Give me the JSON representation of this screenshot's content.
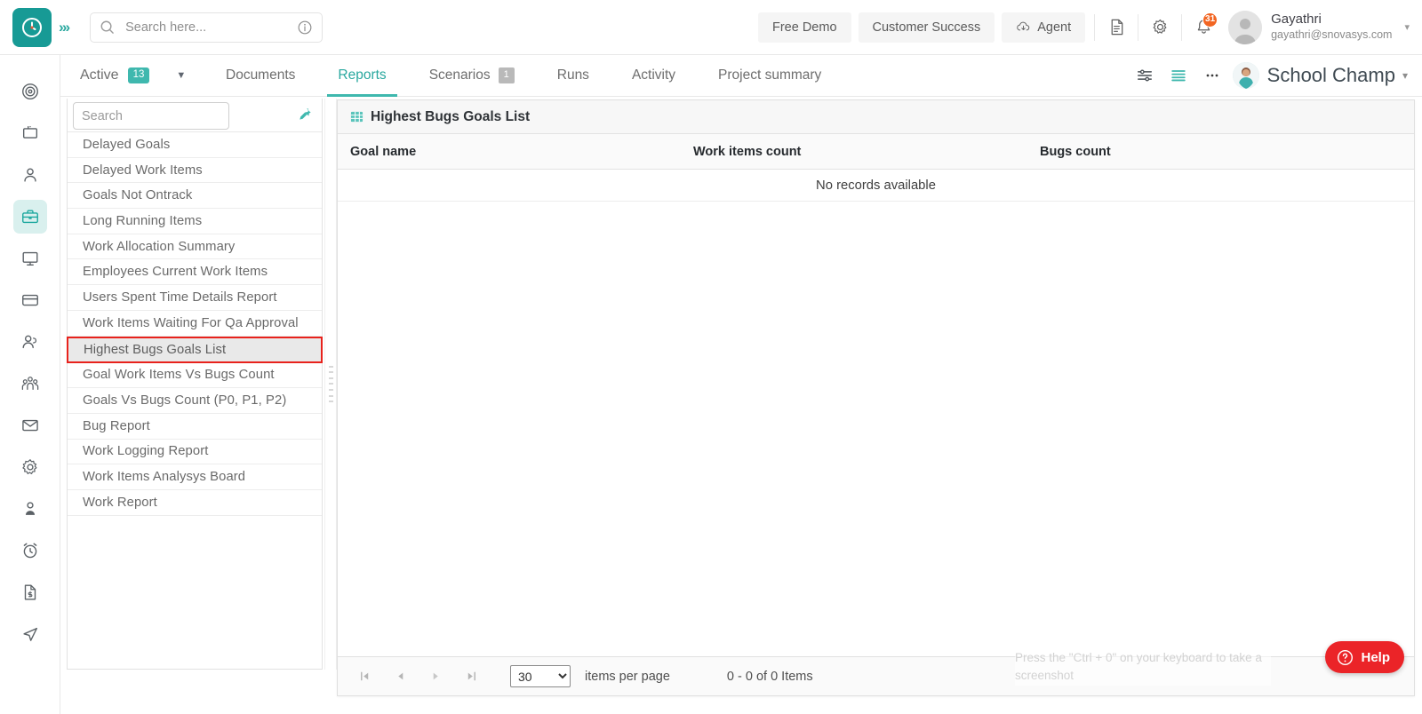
{
  "header": {
    "logo_icon": "clock-logo-icon",
    "expand_icon": "chevrons-right-icon",
    "search": {
      "placeholder": "Search here...",
      "value": "",
      "icon": "search-icon",
      "info_icon": "info-icon"
    },
    "buttons": [
      {
        "label": "Free Demo",
        "name": "free-demo-button"
      },
      {
        "label": "Customer Success",
        "name": "customer-success-button"
      },
      {
        "label": "Agent",
        "name": "agent-button",
        "icon": "cloud-download-icon"
      }
    ],
    "doc_icon": "document-icon",
    "settings_icon": "gear-icon",
    "notifications_icon": "bell-icon",
    "notifications_count": "31",
    "user": {
      "name": "Gayathri",
      "email": "gayathri@snovasys.com",
      "avatar": "user-avatar",
      "caret": "chevron-down-icon"
    }
  },
  "rail": {
    "items": [
      {
        "name": "sidebar-item-goals",
        "icon": "target-icon",
        "active": false
      },
      {
        "name": "sidebar-item-presentations",
        "icon": "presentation-icon",
        "active": false
      },
      {
        "name": "sidebar-item-profile",
        "icon": "person-icon",
        "active": false
      },
      {
        "name": "sidebar-item-projects",
        "icon": "briefcase-icon",
        "active": true
      },
      {
        "name": "sidebar-item-desktop",
        "icon": "monitor-icon",
        "active": false
      },
      {
        "name": "sidebar-item-payments",
        "icon": "credit-card-icon",
        "active": false
      },
      {
        "name": "sidebar-item-clients",
        "icon": "user-add-icon",
        "active": false
      },
      {
        "name": "sidebar-item-teams",
        "icon": "people-group-icon",
        "active": false
      },
      {
        "name": "sidebar-item-mail",
        "icon": "envelope-icon",
        "active": false
      },
      {
        "name": "sidebar-item-settings",
        "icon": "gear-icon",
        "active": false
      },
      {
        "name": "sidebar-item-account",
        "icon": "user-badge-icon",
        "active": false
      },
      {
        "name": "sidebar-item-timesheet",
        "icon": "alarm-clock-icon",
        "active": false
      },
      {
        "name": "sidebar-item-invoices",
        "icon": "invoice-icon",
        "active": false
      },
      {
        "name": "sidebar-item-send",
        "icon": "paper-plane-icon",
        "active": false
      }
    ]
  },
  "subheader": {
    "status_label": "Active",
    "status_count": "13",
    "status_caret": "chevron-down-icon",
    "tabs": [
      {
        "label": "Documents",
        "name": "tab-documents",
        "active": false,
        "badge": ""
      },
      {
        "label": "Reports",
        "name": "tab-reports",
        "active": true,
        "badge": ""
      },
      {
        "label": "Scenarios",
        "name": "tab-scenarios",
        "active": false,
        "badge": "1"
      },
      {
        "label": "Runs",
        "name": "tab-runs",
        "active": false,
        "badge": ""
      },
      {
        "label": "Activity",
        "name": "tab-activity",
        "active": false,
        "badge": ""
      },
      {
        "label": "Project summary",
        "name": "tab-project-summary",
        "active": false,
        "badge": ""
      }
    ],
    "filter_icon": "sliders-icon",
    "list_icon": "list-view-icon",
    "more_icon": "more-horizontal-icon",
    "project_name": "School Champ",
    "project_caret": "chevron-down-icon"
  },
  "reports_panel": {
    "search_placeholder": "Search",
    "search_value": "",
    "pin_icon": "pin-icon",
    "items": [
      {
        "label": "Delayed Goals",
        "selected": false
      },
      {
        "label": "Delayed Work Items",
        "selected": false
      },
      {
        "label": "Goals Not Ontrack",
        "selected": false
      },
      {
        "label": "Long Running Items",
        "selected": false
      },
      {
        "label": "Work Allocation Summary",
        "selected": false
      },
      {
        "label": "Employees Current Work Items",
        "selected": false
      },
      {
        "label": "Users Spent Time Details Report",
        "selected": false
      },
      {
        "label": "Work Items Waiting For Qa Approval",
        "selected": false
      },
      {
        "label": "Highest Bugs Goals List",
        "selected": true
      },
      {
        "label": "Goal Work Items Vs Bugs Count",
        "selected": false
      },
      {
        "label": "Goals Vs Bugs Count (P0, P1, P2)",
        "selected": false
      },
      {
        "label": "Bug Report",
        "selected": false
      },
      {
        "label": "Work Logging Report",
        "selected": false
      },
      {
        "label": "Work Items Analysys Board",
        "selected": false
      },
      {
        "label": "Work Report",
        "selected": false
      }
    ]
  },
  "grid": {
    "title": "Highest Bugs Goals List",
    "title_icon": "grid-icon",
    "columns": [
      "Goal name",
      "Work items count",
      "Bugs count"
    ],
    "rows": [],
    "empty_message": "No records available",
    "footer": {
      "first_icon": "page-first-icon",
      "prev_icon": "page-prev-icon",
      "next_icon": "page-next-icon",
      "last_icon": "page-last-icon",
      "page_size": "30",
      "page_size_options": [
        "30"
      ],
      "items_per_page_label": "items per page",
      "range_label": "0 - 0 of 0 Items"
    }
  },
  "overlay": {
    "screenshot_hint": "Press the \"Ctrl + 0\" on your keyboard to take a screenshot",
    "help_label": "Help",
    "help_icon": "question-circle-icon",
    "help_color": "#eb2428"
  }
}
